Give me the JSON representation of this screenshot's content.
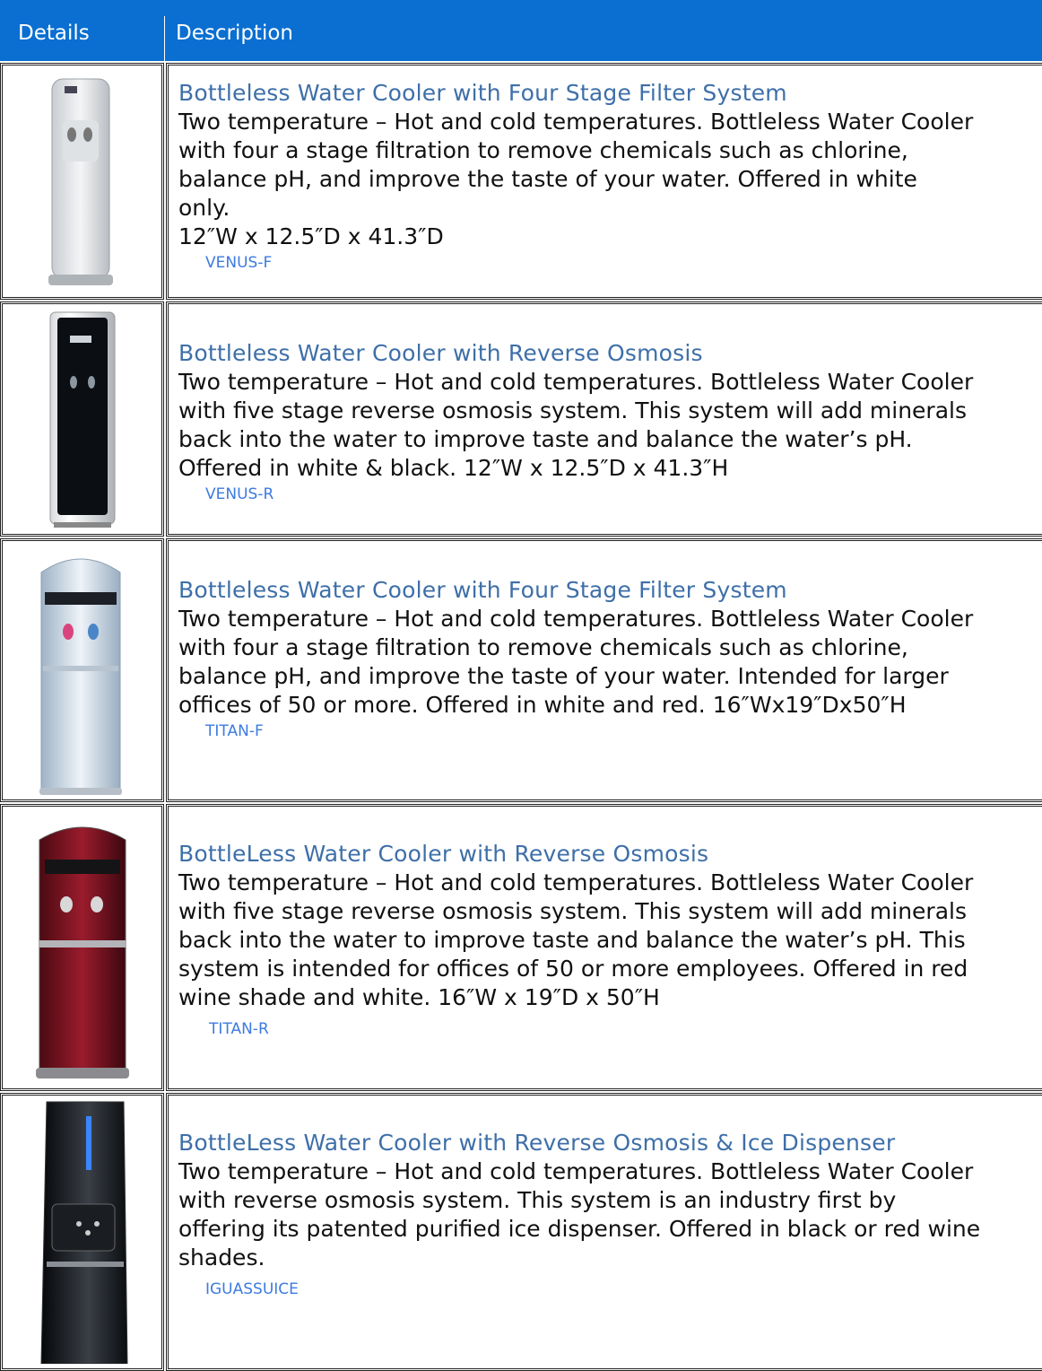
{
  "header": {
    "details_label": "Details",
    "description_label": "Description"
  },
  "colors": {
    "header_bg": "#0a6fd1",
    "title": "#3e6fa8",
    "model_link": "#3d7be0"
  },
  "products": [
    {
      "image_icon": "white-slim-water-cooler",
      "title": "Bottleless Water Cooler with Four Stage Filter System",
      "lines": [
        "Two temperature – Hot and cold temperatures. Bottleless Water Cooler",
        "with four a stage filtration to remove chemicals such as chlorine,",
        "balance pH, and improve the taste of your water. Offered in white",
        "only.",
        "12″W x 12.5″D x 41.3″D"
      ],
      "model": "VENUS-F"
    },
    {
      "image_icon": "black-slim-water-cooler",
      "title": "Bottleless Water Cooler with Reverse Osmosis",
      "lines": [
        "Two temperature – Hot and cold temperatures. Bottleless Water Cooler",
        "with five stage reverse osmosis system. This system will add minerals",
        "back into the water to improve taste and balance the water’s pH.",
        "Offered in white & black. 12″W x 12.5″D x 41.3″H"
      ],
      "model": "VENUS-R"
    },
    {
      "image_icon": "white-large-water-cooler",
      "title": "Bottleless Water Cooler with Four Stage Filter System",
      "lines": [
        "Two temperature – Hot and cold temperatures. Bottleless Water Cooler",
        "with four a stage filtration to remove chemicals such as chlorine,",
        "balance pH, and improve the taste of your water. Intended for larger",
        "offices of 50 or more.  Offered in white and red.  16″Wx19″Dx50″H"
      ],
      "model": "TITAN-F"
    },
    {
      "image_icon": "red-wine-water-cooler",
      "title": "BottleLess Water Cooler with Reverse Osmosis",
      "lines": [
        "Two temperature – Hot and cold temperatures. Bottleless Water Cooler",
        "with five stage reverse osmosis system. This system will add minerals",
        "back into the water to improve taste and balance the water’s pH. This",
        "system is intended for offices of 50 or more employees.  Offered in red",
        "wine shade and white.  16″W x 19″D x 50″H"
      ],
      "model": "TITAN-R"
    },
    {
      "image_icon": "black-ice-dispenser-cooler",
      "title": "BottleLess Water Cooler with Reverse Osmosis & Ice Dispenser",
      "lines": [
        "Two temperature – Hot and cold temperatures. Bottleless Water Cooler",
        "with reverse osmosis system. This system is an industry first by",
        "offering its patented purified ice dispenser. Offered in black or red wine",
        "shades."
      ],
      "model": "IGUASSUICE"
    }
  ]
}
